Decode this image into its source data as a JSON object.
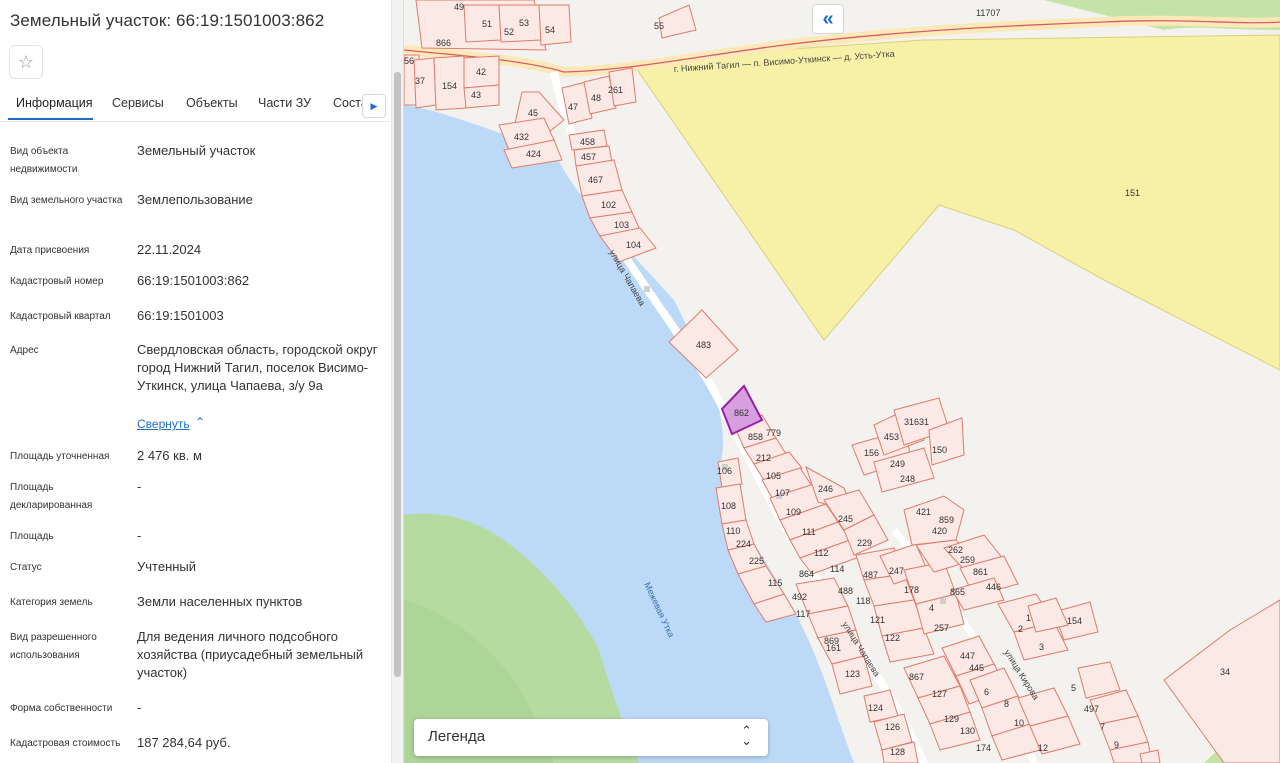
{
  "panel": {
    "title": "Земельный участок: 66:19:1501003:862",
    "tabs": [
      "Информация",
      "Сервисы",
      "Объекты",
      "Части ЗУ",
      "Соста"
    ],
    "collapse_link": "Свернуть",
    "fields": [
      {
        "label": "Вид объекта недвижимости",
        "value": "Земельный участок"
      },
      {
        "label": "Вид земельного участка",
        "value": "Землепользование"
      },
      {
        "label": "Дата присвоения",
        "value": "22.11.2024"
      },
      {
        "label": "Кадастровый номер",
        "value": "66:19:1501003:862"
      },
      {
        "label": "Кадастровый квартал",
        "value": "66:19:1501003"
      },
      {
        "label": "Адрес",
        "value": "Свердловская область, городской округ город Нижний Тагил, поселок Висимо-Уткинск, улица Чапаева, з/у 9а"
      },
      {
        "label": "Площадь уточненная",
        "value": "2 476 кв. м"
      },
      {
        "label": "Площадь декларированная",
        "value": "-"
      },
      {
        "label": "Площадь",
        "value": "-"
      },
      {
        "label": "Статус",
        "value": "Учтенный"
      },
      {
        "label": "Категория земель",
        "value": "Земли населенных пунктов"
      },
      {
        "label": "Вид разрешенного использования",
        "value": "Для ведения личного подсобного хозяйства (приусадебный земельный участок)"
      },
      {
        "label": "Форма собственности",
        "value": "-"
      },
      {
        "label": "Кадастровая стоимость",
        "value": "187 284,64 руб."
      }
    ]
  },
  "map": {
    "road_label": "г. Нижний Тагил — п. Висимо-Уткинск — д. Усть-Утка",
    "street_labels": [
      "улица Чапаева",
      "улица Чапаева",
      "улица Кирова"
    ],
    "river_label": "Межевая Утка",
    "selected_parcel": "862",
    "parcel_labels": [
      "11707",
      "151",
      "483",
      "34",
      "55",
      "45",
      "47",
      "48",
      "261",
      "432",
      "424",
      "458",
      "457",
      "467",
      "102",
      "103",
      "104",
      "866",
      "49",
      "51",
      "52",
      "53",
      "54",
      "56",
      "37",
      "154",
      "42",
      "43",
      "858",
      "779",
      "212",
      "105",
      "107",
      "109",
      "111",
      "112",
      "114",
      "864",
      "106",
      "108",
      "110",
      "224",
      "225",
      "115",
      "492",
      "117",
      "161",
      "869",
      "123",
      "246",
      "245",
      "229",
      "487",
      "247",
      "488",
      "178",
      "118",
      "121",
      "4",
      "122",
      "257",
      "156",
      "453",
      "31631",
      "150",
      "249",
      "248",
      "421",
      "859",
      "420",
      "262",
      "259",
      "861",
      "446",
      "865",
      "1",
      "2",
      "154",
      "3",
      "447",
      "445",
      "867",
      "127",
      "6",
      "8",
      "10",
      "129",
      "130",
      "174",
      "12",
      "124",
      "126",
      "128",
      "5",
      "497",
      "7",
      "9"
    ],
    "legend_label": "Легенда"
  },
  "colors": {
    "accent": "#1e6ec8",
    "parcel_stroke": "#e07b6c",
    "parcel_fill": "#fbe9e5",
    "selected_stroke": "#9b1fa5",
    "selected_fill": "#d69fdd",
    "forest_zone": "#f6f2a6",
    "water": "#bcd9f7",
    "green": "#b7dca2"
  }
}
